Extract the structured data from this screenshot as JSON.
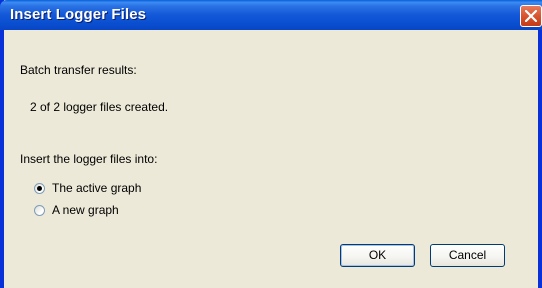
{
  "window": {
    "title": "Insert Logger Files"
  },
  "content": {
    "results_label": "Batch transfer results:",
    "results_value": "2 of 2 logger files created.",
    "insert_label": "Insert the logger files into:",
    "options": [
      {
        "label": "The active graph",
        "selected": true
      },
      {
        "label": "A new graph",
        "selected": false
      }
    ]
  },
  "buttons": {
    "ok": "OK",
    "cancel": "Cancel"
  },
  "icons": {
    "close": "close-icon"
  },
  "colors": {
    "titlebar": "#0a4ed0",
    "face": "#ece9d8",
    "close": "#d8542f"
  }
}
